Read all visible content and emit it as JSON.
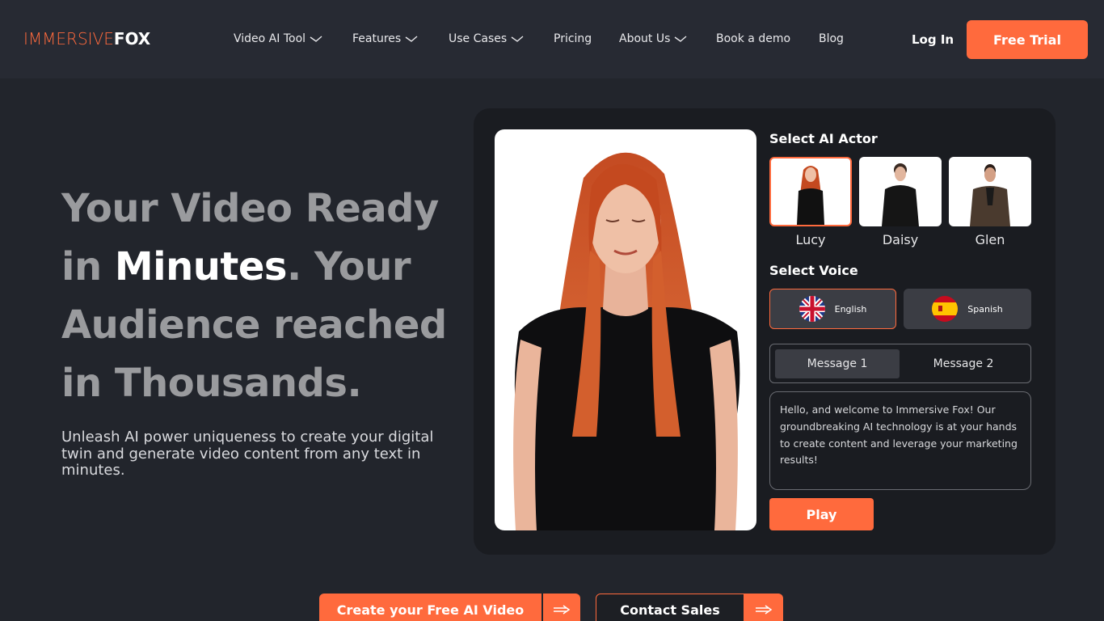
{
  "header": {
    "logo_part1": "IMMERSIVE",
    "logo_part2": "FOX",
    "nav": [
      {
        "label": "Video AI Tool",
        "has_dropdown": true
      },
      {
        "label": "Features",
        "has_dropdown": true
      },
      {
        "label": "Use Cases",
        "has_dropdown": true
      },
      {
        "label": "Pricing",
        "has_dropdown": false
      },
      {
        "label": "About Us",
        "has_dropdown": true
      },
      {
        "label": "Book a demo",
        "has_dropdown": false
      },
      {
        "label": "Blog",
        "has_dropdown": false
      }
    ],
    "login_label": "Log In",
    "trial_label": "Free Trial"
  },
  "hero": {
    "title_line1": "Your Video Ready",
    "title_in": "in ",
    "title_highlight": "Minutes",
    "title_rest": ". Your",
    "title_line3": "Audience reached",
    "title_line4": "in Thousands.",
    "subtitle": "Unleash AI power uniqueness to create your digital twin and generate video content from any text in minutes."
  },
  "demo": {
    "select_actor_title": "Select AI Actor",
    "actors": [
      {
        "name": "Lucy",
        "selected": true
      },
      {
        "name": "Daisy",
        "selected": false
      },
      {
        "name": "Glen",
        "selected": false
      }
    ],
    "select_voice_title": "Select Voice",
    "voices": [
      {
        "label": "English",
        "icon": "uk-flag-icon",
        "selected": true
      },
      {
        "label": "Spanish",
        "icon": "spain-flag-icon",
        "selected": false
      }
    ],
    "message_tabs": [
      "Message 1",
      "Message 2"
    ],
    "active_message": "Message 1",
    "message_text": "Hello, and welcome to Immersive Fox! Our groundbreaking AI technology is at your hands to create content and leverage your marketing results!",
    "play_label": "Play"
  },
  "ctas": {
    "primary_label": "Create your Free AI Video",
    "secondary_label": "Contact Sales",
    "arrow_icon": "double-arrow-right-icon"
  },
  "colors": {
    "accent": "#ff6a3d",
    "background": "#22252c",
    "header": "#272a33",
    "panel": "#1a1c21"
  }
}
